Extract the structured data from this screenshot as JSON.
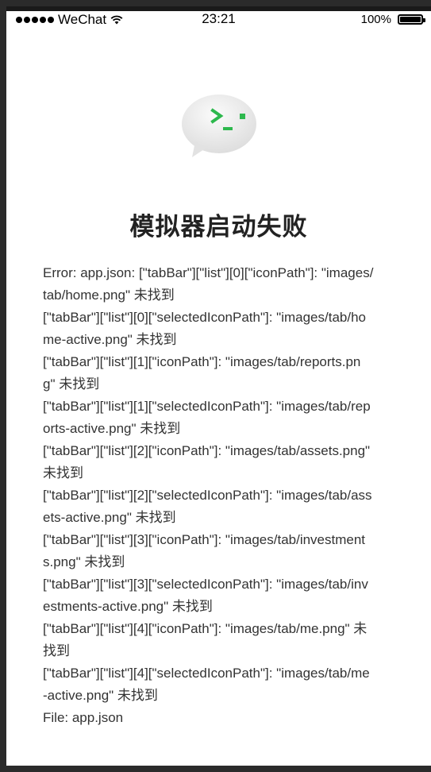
{
  "status_bar": {
    "carrier": "WeChat",
    "time": "23:21",
    "battery_percent": "100%",
    "battery_level": 1.0
  },
  "logo": {
    "icon": "wechat-devtools-terminal-bubble-icon",
    "prompt_color": "#2db84d"
  },
  "title": "模拟器启动失败",
  "message_lines": [
    "Error: app.json: [\"tabBar\"][\"list\"][0][\"iconPath\"]: \"images/",
    "tab/home.png\" 未找到",
    "[\"tabBar\"][\"list\"][0][\"selectedIconPath\"]: \"images/tab/ho",
    "me-active.png\" 未找到",
    "[\"tabBar\"][\"list\"][1][\"iconPath\"]: \"images/tab/reports.pn",
    "g\" 未找到",
    "[\"tabBar\"][\"list\"][1][\"selectedIconPath\"]: \"images/tab/rep",
    "orts-active.png\" 未找到",
    "[\"tabBar\"][\"list\"][2][\"iconPath\"]: \"images/tab/assets.png\"",
    "未找到",
    "[\"tabBar\"][\"list\"][2][\"selectedIconPath\"]: \"images/tab/ass",
    "ets-active.png\" 未找到",
    "[\"tabBar\"][\"list\"][3][\"iconPath\"]: \"images/tab/investment",
    "s.png\" 未找到",
    "[\"tabBar\"][\"list\"][3][\"selectedIconPath\"]: \"images/tab/inv",
    "estments-active.png\" 未找到",
    "[\"tabBar\"][\"list\"][4][\"iconPath\"]: \"images/tab/me.png\" 未",
    "找到",
    "[\"tabBar\"][\"list\"][4][\"selectedIconPath\"]: \"images/tab/me",
    "-active.png\" 未找到",
    "File: app.json"
  ]
}
